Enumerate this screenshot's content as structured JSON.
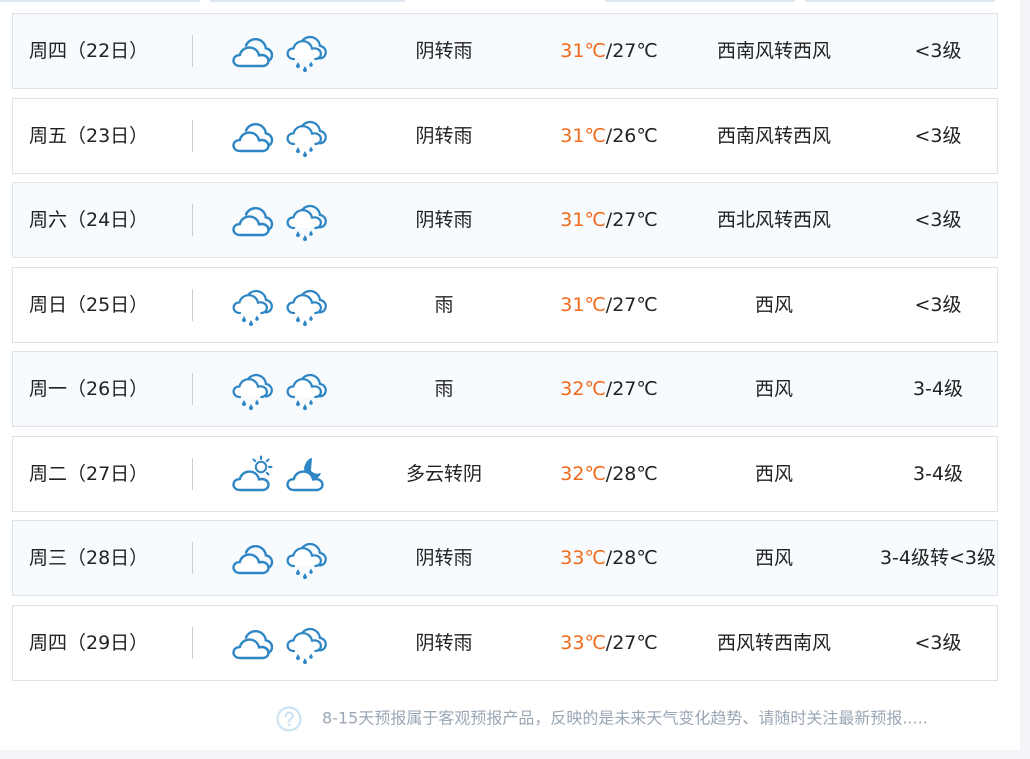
{
  "forecast": [
    {
      "day": "周四（22日）",
      "icons": [
        "overcast-icon",
        "rain-icon"
      ],
      "weather": "阴转雨",
      "high": "31℃",
      "low": "/27℃",
      "wind": "西南风转西风",
      "level": "<3级"
    },
    {
      "day": "周五（23日）",
      "icons": [
        "overcast-icon",
        "rain-icon"
      ],
      "weather": "阴转雨",
      "high": "31℃",
      "low": "/26℃",
      "wind": "西南风转西风",
      "level": "<3级"
    },
    {
      "day": "周六（24日）",
      "icons": [
        "overcast-icon",
        "rain-icon"
      ],
      "weather": "阴转雨",
      "high": "31℃",
      "low": "/27℃",
      "wind": "西北风转西风",
      "level": "<3级"
    },
    {
      "day": "周日（25日）",
      "icons": [
        "rain-icon",
        "rain-icon"
      ],
      "weather": "雨",
      "high": "31℃",
      "low": "/27℃",
      "wind": "西风",
      "level": "<3级"
    },
    {
      "day": "周一（26日）",
      "icons": [
        "rain-icon",
        "rain-icon"
      ],
      "weather": "雨",
      "high": "32℃",
      "low": "/27℃",
      "wind": "西风",
      "level": "3-4级"
    },
    {
      "day": "周二（27日）",
      "icons": [
        "partly-cloudy-day-icon",
        "partly-cloudy-night-icon"
      ],
      "weather": "多云转阴",
      "high": "32℃",
      "low": "/28℃",
      "wind": "西风",
      "level": "3-4级"
    },
    {
      "day": "周三（28日）",
      "icons": [
        "overcast-icon",
        "rain-icon"
      ],
      "weather": "阴转雨",
      "high": "33℃",
      "low": "/28℃",
      "wind": "西风",
      "level": "3-4级转<3级"
    },
    {
      "day": "周四（29日）",
      "icons": [
        "overcast-icon",
        "rain-icon"
      ],
      "weather": "阴转雨",
      "high": "33℃",
      "low": "/27℃",
      "wind": "西风转西南风",
      "level": "<3级"
    }
  ],
  "footnote": {
    "icon": "help-circle-icon",
    "text": "8-15天预报属于客观预报产品，反映的是未来天气变化趋势、请随时关注最新预报....."
  },
  "colors": {
    "high_temp": "#f06a1a",
    "icon_stroke": "#2f86c5",
    "row_alt_bg": "#f7fbfe",
    "border": "#dde3ea"
  }
}
